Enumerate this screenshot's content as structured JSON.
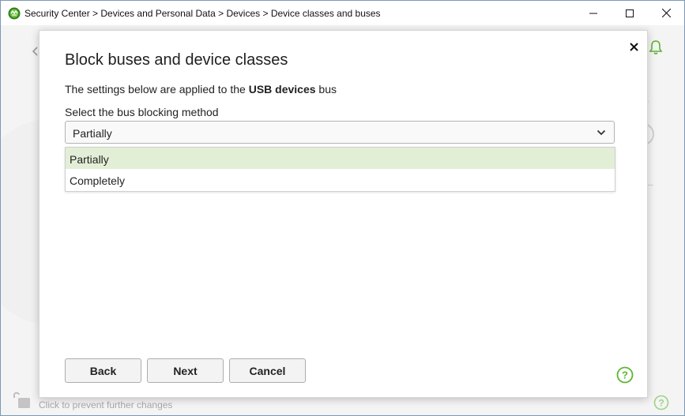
{
  "window": {
    "title": "Security Center > Devices and Personal Data > Devices > Device classes and buses"
  },
  "background": {
    "footer_text": "Click to prevent further changes"
  },
  "dialog": {
    "title": "Block buses and device classes",
    "desc_prefix": "The settings below are applied to the ",
    "desc_bold": "USB devices",
    "desc_suffix": " bus",
    "field_label": "Select the bus blocking method",
    "selected_value": "Partially",
    "options": [
      "Partially",
      "Completely"
    ],
    "buttons": {
      "back": "Back",
      "next": "Next",
      "cancel": "Cancel"
    }
  },
  "colors": {
    "accent_green": "#5cb531",
    "selected_option_bg": "#e2efd6"
  }
}
